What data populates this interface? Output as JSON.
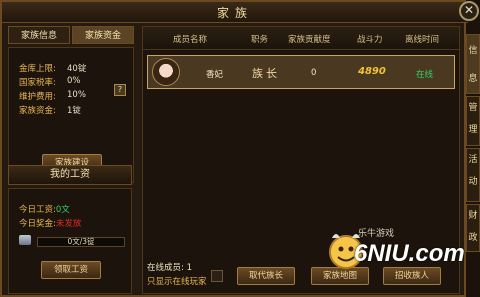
{
  "window": {
    "title": "家族"
  },
  "left_panel": {
    "tabs": [
      {
        "label": "家族信息",
        "active": true
      },
      {
        "label": "家族资金",
        "active": false
      }
    ],
    "info": [
      {
        "label": "金库上限:",
        "value": "40锭"
      },
      {
        "label": "国家税率:",
        "value": "0%"
      },
      {
        "label": "维护费用:",
        "value": "10%"
      },
      {
        "label": "家族资金:",
        "value": "1锭"
      }
    ],
    "help_label": "?",
    "build_button": "家族建设",
    "wage_title": "我的工资",
    "today_wage_label": "今日工资:",
    "today_wage_value": "0文",
    "today_bonus_label": "今日奖金:",
    "today_bonus_value": "未发放",
    "wage_progress_text": "0文/3锭",
    "claim_button": "领取工资"
  },
  "member_table": {
    "headers": [
      "成员名称",
      "职务",
      "家族贡献度",
      "战斗力",
      "离线时间"
    ],
    "rows": [
      {
        "name": "香妃",
        "role": "族长",
        "contribution": "0",
        "power": "4890",
        "status": "在线"
      }
    ]
  },
  "footer": {
    "online_members_label": "在线成员:",
    "online_members_value": "1",
    "show_online_only": "只显示在线玩家",
    "replace_leader_button": "取代族长",
    "family_map_button": "家族地图",
    "recruit_button": "招收族人"
  },
  "side_tabs": [
    "信息",
    "管理",
    "活动",
    "财政"
  ],
  "watermark": {
    "text": "6NIU.com",
    "caption": "乐牛游戏"
  },
  "colors": {
    "accent": "#c9a45a",
    "online": "#2fd06b",
    "alert": "#e02b2b",
    "gold": "#e6b550"
  }
}
